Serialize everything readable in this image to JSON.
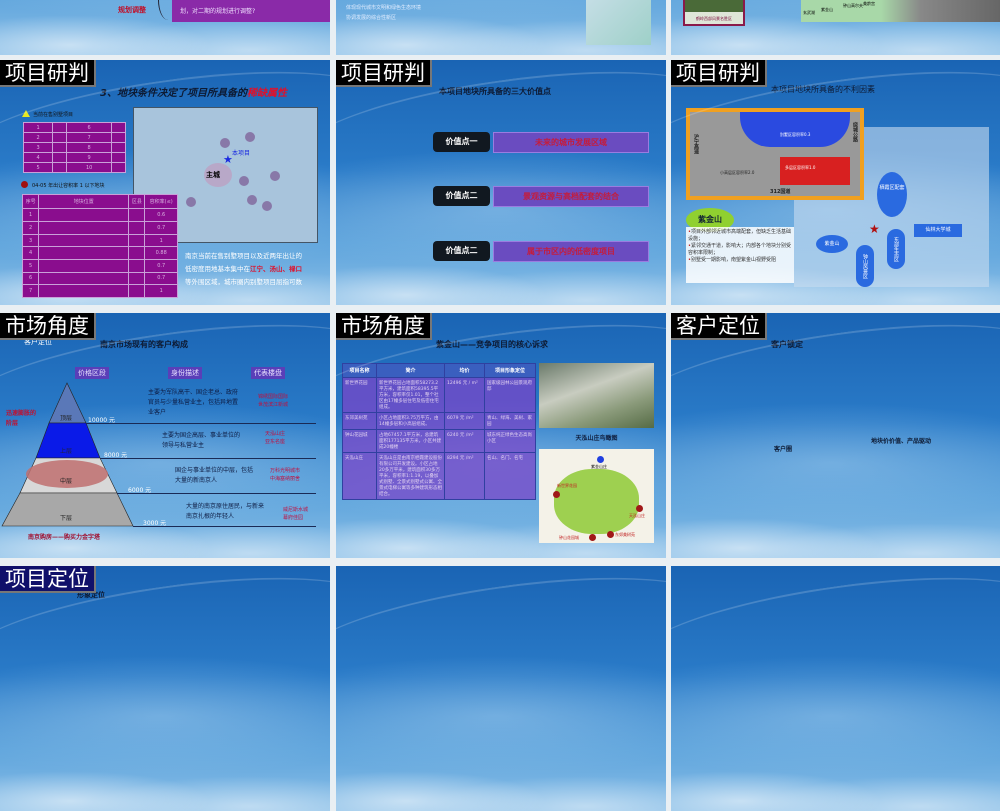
{
  "row1": {
    "slide_a": {
      "box_text": "划，对二期的规划进行调整?",
      "label": "规划调整"
    },
    "slide_b": {
      "lines": [
        "体现现代城市文明和绿色生态环境",
        "协调发展的综合性新区"
      ]
    },
    "slide_c": {
      "caption": "鹤岭西部风景名胜区",
      "map_labels": [
        "玄武湖",
        "紫金山",
        "钟山高尔夫",
        "美龄宫"
      ]
    }
  },
  "slide_scarcity": {
    "section": "项目研判",
    "subtitle_prefix": "3、地块条件决定了项目所具备的",
    "subtitle_highlight": "稀缺属性",
    "legend_triangle": "当前在售别墅项目",
    "table1_numbers": [
      "1",
      "2",
      "3",
      "4",
      "5",
      "6",
      "7",
      "8",
      "9",
      "10"
    ],
    "legend_circle": "04-05 年出让容积率 1 以下地块",
    "table2_header": [
      "序号",
      "地块位置",
      "区县",
      "容积率(≤)"
    ],
    "table2_rows": [
      [
        "1",
        "0.6"
      ],
      [
        "2",
        "0.7"
      ],
      [
        "3",
        "1"
      ],
      [
        "4",
        "0.88"
      ],
      [
        "5",
        "0.7"
      ],
      [
        "6",
        "0.7"
      ],
      [
        "7",
        "1"
      ]
    ],
    "map": {
      "project_label": "本项目",
      "city_label": "主城"
    },
    "note_line1": "南京当前在售别墅项目以及近两年出让的",
    "note_line2_prefix": "低密度用地基本集中在",
    "note_districts": "江宁、汤山、禄口",
    "note_line3": "等外围区域，城市圈内别墅项目屈指可数"
  },
  "slide_values": {
    "section": "项目研判",
    "subtitle": "本项目地块所具备的三大价值点",
    "points": [
      {
        "label": "价值点一",
        "text": "未来的城市发展区域"
      },
      {
        "label": "价值点二",
        "text": "景观资源与高档配套的结合"
      },
      {
        "label": "价值点二",
        "text": "属于市区内的低密度项目"
      }
    ]
  },
  "slide_disadvantages": {
    "section": "项目研判",
    "subtitle": "本项目地块所具备的不利因素",
    "plan_labels": {
      "villa": "别墅区容积率0.3",
      "high": "小高层区容积率2.0",
      "multi": "多层区容积率1.0",
      "road": "312国道",
      "west": "沪宁高速",
      "east": "绕城公路"
    },
    "tag": "紫金山",
    "bullets": [
      "项目外部邻近城市高端配套，但缺乏生活基础设施；",
      "紧邻交通干道，影响大；内部各个地块分别受容积率限制；",
      "别墅受一期影响，南望紫金山视野受阻"
    ],
    "map_labels": [
      "栖霞区配套",
      "仙林大学城",
      "紫金山",
      "东部生态区",
      "钟山风景区"
    ]
  },
  "slide_pyramid": {
    "section": "市场角度",
    "hidden_title": "客户定位",
    "subtitle": "南京市场现有的客户构成",
    "headers": [
      "价格区段",
      "身份描述",
      "代表楼盘"
    ],
    "left_note": "迅速膨胀的阶层",
    "layers": [
      {
        "name": "顶层",
        "price": "10000 元",
        "desc": "主要为军队高干、国企老总、政府官员与少量私营业主，包括异地置业客户",
        "reps": "锦绣国际国际\n世茂滨江新城"
      },
      {
        "name": "上层",
        "price": "8000 元",
        "desc": "主要为国企高层、事业单位的领导与私营业主",
        "reps": "天泓山庄\n亚东名座"
      },
      {
        "name": "中层",
        "price": "6000 元",
        "desc": "国企与事业单位的中层，包括大量的新南京人",
        "reps": "万科光明城市\n中海塞纳丽舍"
      },
      {
        "name": "下层",
        "price": "3000 元",
        "desc": "大量的南京原住居民，与新来南京扎根的年轻人",
        "reps": "威尼斯水城\n幕府佳园"
      }
    ],
    "caption": "南京购房——购买力金字塔"
  },
  "slide_competition": {
    "section": "市场角度",
    "subtitle": "紫金山——竞争项目的核心诉求",
    "columns": [
      "项目名称",
      "简介",
      "均价",
      "项目形象定位"
    ],
    "rows": [
      [
        "新世界花园",
        "新世界花园占地面积58273.2平方米，建筑面积58395.5平方米，容积率仅1.01，整个社区由17幢多层住宅及低密住宅组成。",
        "12496 元 / m²",
        "国家级园林公园景观府邸"
      ],
      [
        "东郊美树苑",
        "小区占地面积3.75万平方，由14幢多层和小高层组成。",
        "6079 元 /m²",
        "青山、绿海、美树、家园"
      ],
      [
        "钟山花园城",
        "占地67457.1平方米，总建筑面积177135平方米，小区共建成20幢楼",
        "6240 元 /m²",
        "城东纯正绿色生态高尚小区"
      ],
      [
        "天泓山庄",
        "天泓山庄是由南京栖霞建设股份有限公司开发建设。小区占地20多万平米，建筑面积30多万平米，容积率1:1.19，以叠加式别墅、全景式别墅式公寓、全景式电梯公寓等多种建筑形态相结合。",
        "8294 元 /m²",
        "名山、名门、名宅"
      ]
    ],
    "photo_caption": "天泓山庄鸟瞰图",
    "map_labels": [
      "紫金山庄",
      "新世界花园",
      "天泓山庄",
      "东郊美树苑",
      "钟山花园城"
    ]
  },
  "slide_client": {
    "section": "客户定位",
    "subtitle": "客户锁定",
    "circle_label": "客户圈",
    "driver_label": "地块价价值、产品驱动"
  },
  "slide_positioning": {
    "section": "项目定位",
    "subtitle": "形象定位"
  }
}
